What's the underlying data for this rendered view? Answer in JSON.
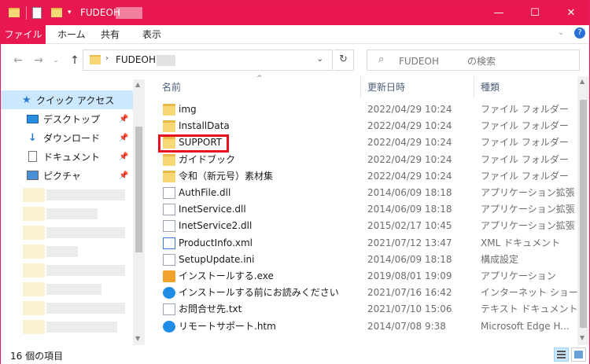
{
  "window": {
    "title": "FUDEOH",
    "accent": "#e8174f"
  },
  "ribbon": {
    "tabs": [
      "ファイル",
      "ホーム",
      "共有",
      "表示"
    ]
  },
  "address": {
    "crumb": "FUDEOH",
    "search_placeholder": "FUDEOH　　　の検索"
  },
  "nav": {
    "quick_access": "クイック アクセス",
    "items": [
      {
        "label": "デスクトップ",
        "icon": "desktop-icon"
      },
      {
        "label": "ダウンロード",
        "icon": "download-icon"
      },
      {
        "label": "ドキュメント",
        "icon": "documents-icon"
      },
      {
        "label": "ピクチャ",
        "icon": "pictures-icon"
      }
    ]
  },
  "list": {
    "columns": [
      "名前",
      "更新日時",
      "種類"
    ],
    "rows": [
      {
        "name": "img",
        "date": "2022/04/29 10:24",
        "type": "ファイル フォルダー",
        "icon": "folder"
      },
      {
        "name": "InstallData",
        "date": "2022/04/29 10:24",
        "type": "ファイル フォルダー",
        "icon": "folder"
      },
      {
        "name": "SUPPORT",
        "date": "2022/04/29 10:24",
        "type": "ファイル フォルダー",
        "icon": "folder"
      },
      {
        "name": "ガイドブック",
        "date": "2022/04/29 10:24",
        "type": "ファイル フォルダー",
        "icon": "folder"
      },
      {
        "name": "令和（新元号）素材集",
        "date": "2022/04/29 10:24",
        "type": "ファイル フォルダー",
        "icon": "folder"
      },
      {
        "name": "AuthFile.dll",
        "date": "2014/06/09 18:18",
        "type": "アプリケーション拡張",
        "icon": "doc"
      },
      {
        "name": "InetService.dll",
        "date": "2014/06/09 18:18",
        "type": "アプリケーション拡張",
        "icon": "doc"
      },
      {
        "name": "InetService2.dll",
        "date": "2015/02/17 10:45",
        "type": "アプリケーション拡張",
        "icon": "doc"
      },
      {
        "name": "ProductInfo.xml",
        "date": "2021/07/12 13:47",
        "type": "XML ドキュメント",
        "icon": "xmlic"
      },
      {
        "name": "SetupUpdate.ini",
        "date": "2014/06/09 18:18",
        "type": "構成設定",
        "icon": "doc"
      },
      {
        "name": "インストールする.exe",
        "date": "2019/08/01 19:09",
        "type": "アプリケーション",
        "icon": "setup"
      },
      {
        "name": "インストールする前にお読みください",
        "date": "2021/07/16 16:42",
        "type": "インターネット ショート...",
        "icon": "edge"
      },
      {
        "name": "お問合せ先.txt",
        "date": "2021/07/10 15:06",
        "type": "テキスト ドキュメント",
        "icon": "doc"
      },
      {
        "name": "リモートサポート.htm",
        "date": "2014/07/08 9:38",
        "type": "Microsoft Edge H...",
        "icon": "edge"
      }
    ]
  },
  "status": {
    "item_count": "16 個の項目"
  }
}
